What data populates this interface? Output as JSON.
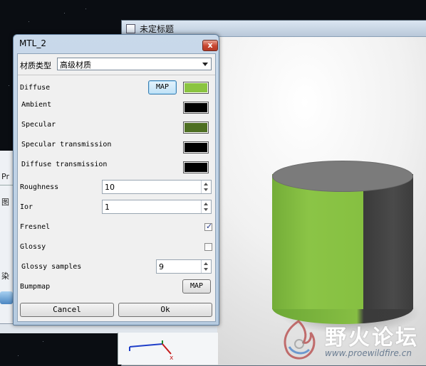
{
  "background_window": {
    "title": "未定标题"
  },
  "left_window": {
    "labels": [
      "Pr",
      "图",
      "染"
    ]
  },
  "watermark": {
    "text_cn": "野火论坛",
    "url": "www.proewildfire.cn"
  },
  "dialog": {
    "title": "MTL_2",
    "close_symbol": "x",
    "material_type_label": "材质类型",
    "material_type_value": "高级材质",
    "rows": {
      "diffuse": {
        "label": "Diffuse",
        "map_label": "MAP",
        "color": "#8bc440"
      },
      "ambient": {
        "label": "Ambient",
        "color": "#000000"
      },
      "specular": {
        "label": "Specular",
        "color": "#4e6f22"
      },
      "specular_transmission": {
        "label": "Specular transmission",
        "color": "#000000"
      },
      "diffuse_transmission": {
        "label": "Diffuse transmission",
        "color": "#000000"
      },
      "roughness": {
        "label": "Roughness",
        "value": "10"
      },
      "ior": {
        "label": "Ior",
        "value": "1"
      },
      "fresnel": {
        "label": "Fresnel",
        "checked": true
      },
      "glossy": {
        "label": "Glossy",
        "checked": false
      },
      "glossy_samples": {
        "label": "Glossy samples",
        "value": "9"
      },
      "bumpmap": {
        "label": "Bumpmap",
        "map_label": "MAP"
      }
    },
    "buttons": {
      "cancel": "Cancel",
      "ok": "Ok"
    }
  }
}
